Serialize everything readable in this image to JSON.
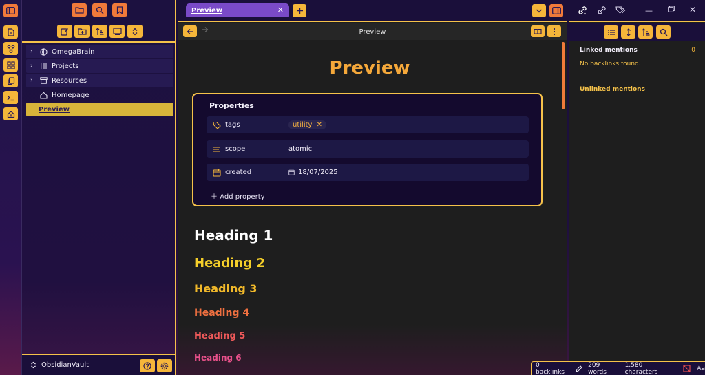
{
  "ribbon": {
    "icons": [
      "sidebar-toggle-icon",
      "new-note-icon",
      "graph-icon",
      "grid-icon",
      "copy-icon",
      "terminal-icon",
      "home-icon"
    ]
  },
  "sidebar": {
    "tree": [
      {
        "label": "OmegaBrain",
        "icon": "brain-icon"
      },
      {
        "label": "Projects",
        "icon": "list-icon"
      },
      {
        "label": "Resources",
        "icon": "archive-icon"
      },
      {
        "label": "Homepage",
        "icon": "home-icon"
      },
      {
        "label": "Preview"
      }
    ],
    "vault_name": "ObsidianVault"
  },
  "tabs": [
    {
      "label": "Preview"
    }
  ],
  "nav": {
    "title": "Preview"
  },
  "note": {
    "title": "Preview",
    "properties": {
      "heading": "Properties",
      "rows": [
        {
          "name": "tags",
          "value": "utility"
        },
        {
          "name": "scope",
          "value": "atomic"
        },
        {
          "name": "created",
          "value": "18/07/2025"
        }
      ],
      "add_label": "Add property"
    },
    "headings": [
      "Heading 1",
      "Heading 2",
      "Heading 3",
      "Heading 4",
      "Heading 5",
      "Heading 6"
    ]
  },
  "backlinks": {
    "linked_label": "Linked mentions",
    "linked_count": "0",
    "empty_text": "No backlinks found.",
    "unlinked_label": "Unlinked mentions"
  },
  "status": {
    "backlinks": "0 backlinks",
    "words": "209 words",
    "characters": "1,580 characters",
    "font_label": "Aa"
  },
  "colors": {
    "accent": "#f5c24a",
    "orange": "#f07a3a",
    "title": "#f5a83a"
  }
}
